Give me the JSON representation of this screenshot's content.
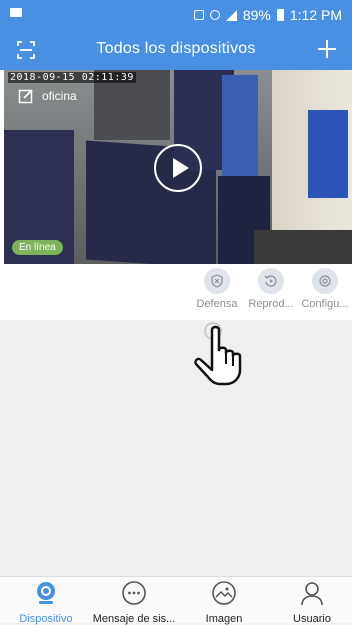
{
  "status_bar": {
    "battery": "89%",
    "time": "1:12 PM"
  },
  "header": {
    "title": "Todos los dispositivos",
    "scan_icon": "scan-icon",
    "add_icon": "plus-icon"
  },
  "device": {
    "timestamp": "2018-09-15 02:11:39",
    "name": "oficina",
    "status": "En línea",
    "actions": [
      {
        "label": "Defensa",
        "icon": "shield-icon"
      },
      {
        "label": "Reprod...",
        "icon": "replay-icon"
      },
      {
        "label": "Configu...",
        "icon": "gear-icon"
      }
    ]
  },
  "tabs": [
    {
      "label": "Dispositivo",
      "icon": "camera-icon",
      "active": true
    },
    {
      "label": "Mensaje de sis...",
      "icon": "message-icon",
      "active": false
    },
    {
      "label": "Imagen",
      "icon": "image-icon",
      "active": false
    },
    {
      "label": "Usuario",
      "icon": "user-icon",
      "active": false
    }
  ],
  "colors": {
    "primary": "#4a90e2",
    "online": "#7db35a"
  }
}
